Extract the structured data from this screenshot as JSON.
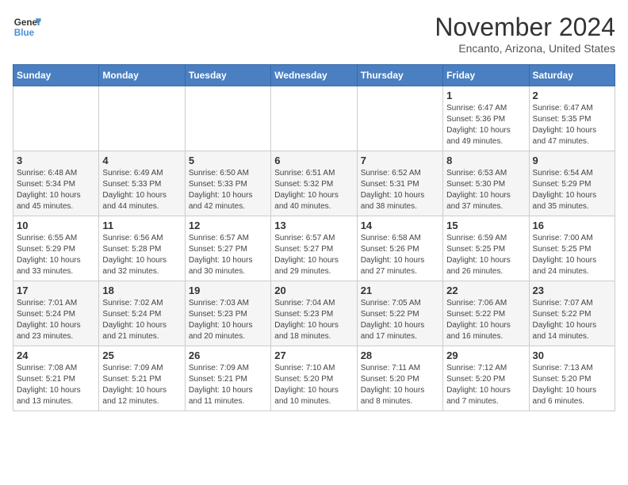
{
  "header": {
    "logo_line1": "General",
    "logo_line2": "Blue",
    "month": "November 2024",
    "location": "Encanto, Arizona, United States"
  },
  "weekdays": [
    "Sunday",
    "Monday",
    "Tuesday",
    "Wednesday",
    "Thursday",
    "Friday",
    "Saturday"
  ],
  "weeks": [
    [
      {
        "day": "",
        "info": ""
      },
      {
        "day": "",
        "info": ""
      },
      {
        "day": "",
        "info": ""
      },
      {
        "day": "",
        "info": ""
      },
      {
        "day": "",
        "info": ""
      },
      {
        "day": "1",
        "info": "Sunrise: 6:47 AM\nSunset: 5:36 PM\nDaylight: 10 hours\nand 49 minutes."
      },
      {
        "day": "2",
        "info": "Sunrise: 6:47 AM\nSunset: 5:35 PM\nDaylight: 10 hours\nand 47 minutes."
      }
    ],
    [
      {
        "day": "3",
        "info": "Sunrise: 6:48 AM\nSunset: 5:34 PM\nDaylight: 10 hours\nand 45 minutes."
      },
      {
        "day": "4",
        "info": "Sunrise: 6:49 AM\nSunset: 5:33 PM\nDaylight: 10 hours\nand 44 minutes."
      },
      {
        "day": "5",
        "info": "Sunrise: 6:50 AM\nSunset: 5:33 PM\nDaylight: 10 hours\nand 42 minutes."
      },
      {
        "day": "6",
        "info": "Sunrise: 6:51 AM\nSunset: 5:32 PM\nDaylight: 10 hours\nand 40 minutes."
      },
      {
        "day": "7",
        "info": "Sunrise: 6:52 AM\nSunset: 5:31 PM\nDaylight: 10 hours\nand 38 minutes."
      },
      {
        "day": "8",
        "info": "Sunrise: 6:53 AM\nSunset: 5:30 PM\nDaylight: 10 hours\nand 37 minutes."
      },
      {
        "day": "9",
        "info": "Sunrise: 6:54 AM\nSunset: 5:29 PM\nDaylight: 10 hours\nand 35 minutes."
      }
    ],
    [
      {
        "day": "10",
        "info": "Sunrise: 6:55 AM\nSunset: 5:29 PM\nDaylight: 10 hours\nand 33 minutes."
      },
      {
        "day": "11",
        "info": "Sunrise: 6:56 AM\nSunset: 5:28 PM\nDaylight: 10 hours\nand 32 minutes."
      },
      {
        "day": "12",
        "info": "Sunrise: 6:57 AM\nSunset: 5:27 PM\nDaylight: 10 hours\nand 30 minutes."
      },
      {
        "day": "13",
        "info": "Sunrise: 6:57 AM\nSunset: 5:27 PM\nDaylight: 10 hours\nand 29 minutes."
      },
      {
        "day": "14",
        "info": "Sunrise: 6:58 AM\nSunset: 5:26 PM\nDaylight: 10 hours\nand 27 minutes."
      },
      {
        "day": "15",
        "info": "Sunrise: 6:59 AM\nSunset: 5:25 PM\nDaylight: 10 hours\nand 26 minutes."
      },
      {
        "day": "16",
        "info": "Sunrise: 7:00 AM\nSunset: 5:25 PM\nDaylight: 10 hours\nand 24 minutes."
      }
    ],
    [
      {
        "day": "17",
        "info": "Sunrise: 7:01 AM\nSunset: 5:24 PM\nDaylight: 10 hours\nand 23 minutes."
      },
      {
        "day": "18",
        "info": "Sunrise: 7:02 AM\nSunset: 5:24 PM\nDaylight: 10 hours\nand 21 minutes."
      },
      {
        "day": "19",
        "info": "Sunrise: 7:03 AM\nSunset: 5:23 PM\nDaylight: 10 hours\nand 20 minutes."
      },
      {
        "day": "20",
        "info": "Sunrise: 7:04 AM\nSunset: 5:23 PM\nDaylight: 10 hours\nand 18 minutes."
      },
      {
        "day": "21",
        "info": "Sunrise: 7:05 AM\nSunset: 5:22 PM\nDaylight: 10 hours\nand 17 minutes."
      },
      {
        "day": "22",
        "info": "Sunrise: 7:06 AM\nSunset: 5:22 PM\nDaylight: 10 hours\nand 16 minutes."
      },
      {
        "day": "23",
        "info": "Sunrise: 7:07 AM\nSunset: 5:22 PM\nDaylight: 10 hours\nand 14 minutes."
      }
    ],
    [
      {
        "day": "24",
        "info": "Sunrise: 7:08 AM\nSunset: 5:21 PM\nDaylight: 10 hours\nand 13 minutes."
      },
      {
        "day": "25",
        "info": "Sunrise: 7:09 AM\nSunset: 5:21 PM\nDaylight: 10 hours\nand 12 minutes."
      },
      {
        "day": "26",
        "info": "Sunrise: 7:09 AM\nSunset: 5:21 PM\nDaylight: 10 hours\nand 11 minutes."
      },
      {
        "day": "27",
        "info": "Sunrise: 7:10 AM\nSunset: 5:20 PM\nDaylight: 10 hours\nand 10 minutes."
      },
      {
        "day": "28",
        "info": "Sunrise: 7:11 AM\nSunset: 5:20 PM\nDaylight: 10 hours\nand 8 minutes."
      },
      {
        "day": "29",
        "info": "Sunrise: 7:12 AM\nSunset: 5:20 PM\nDaylight: 10 hours\nand 7 minutes."
      },
      {
        "day": "30",
        "info": "Sunrise: 7:13 AM\nSunset: 5:20 PM\nDaylight: 10 hours\nand 6 minutes."
      }
    ]
  ]
}
